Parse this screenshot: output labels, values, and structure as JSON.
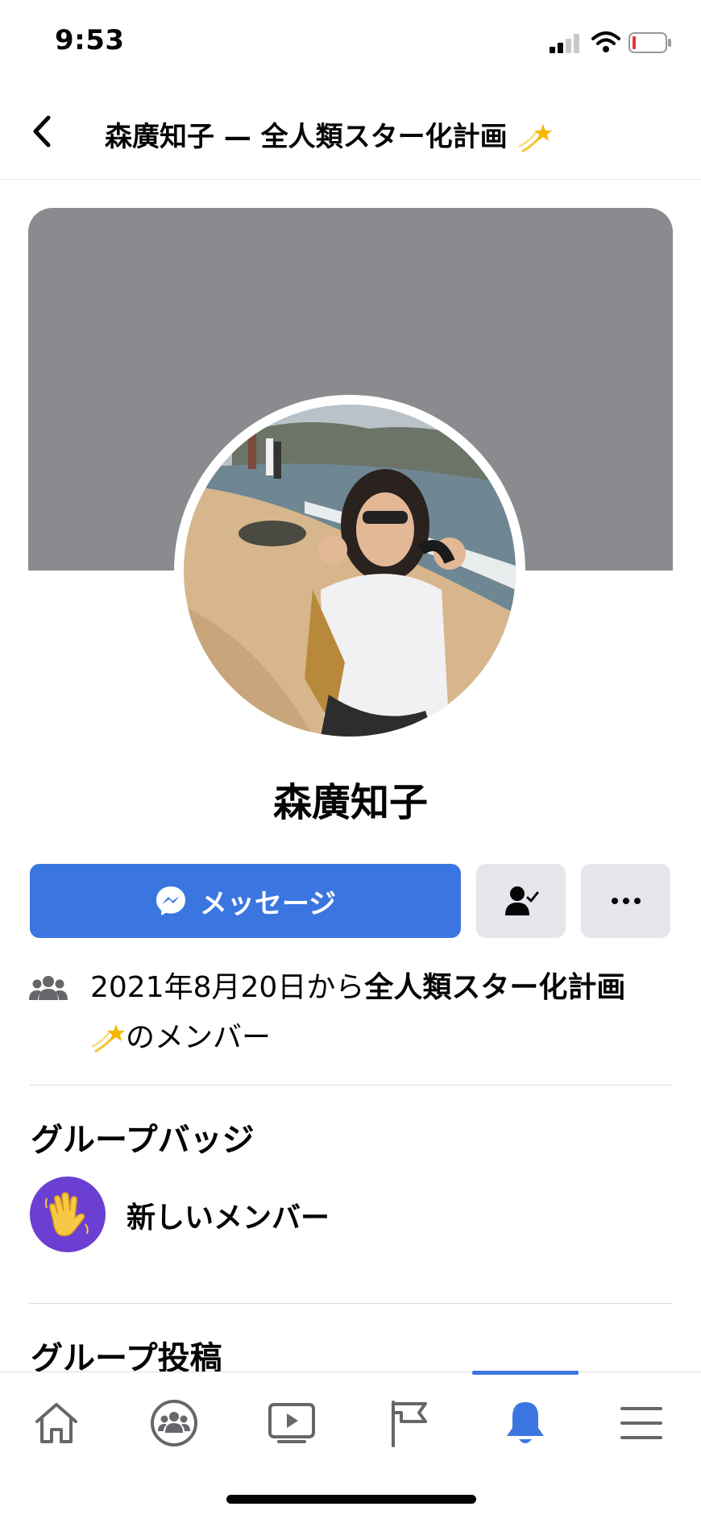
{
  "status_bar": {
    "time": "9:53"
  },
  "header": {
    "title": "森廣知子 — 全人類スター化計画"
  },
  "profile": {
    "name": "森廣知子"
  },
  "actions": {
    "message_label": "メッセージ"
  },
  "membership": {
    "prefix": "2021年8月20日から",
    "group_name": "全人類スター化計画",
    "suffix": "のメンバー"
  },
  "badges": {
    "title": "グループバッジ",
    "items": [
      {
        "label": "新しいメンバー"
      }
    ]
  },
  "posts": {
    "title": "グループ投稿"
  },
  "colors": {
    "accent": "#3b76e0",
    "cover": "#898b8e",
    "badge": "#6b3fd1"
  },
  "tabbar": {
    "active": "notifications",
    "icons": [
      "home-icon",
      "groups-icon",
      "video-icon",
      "pages-flag-icon",
      "notifications-bell-icon",
      "menu-icon"
    ]
  }
}
